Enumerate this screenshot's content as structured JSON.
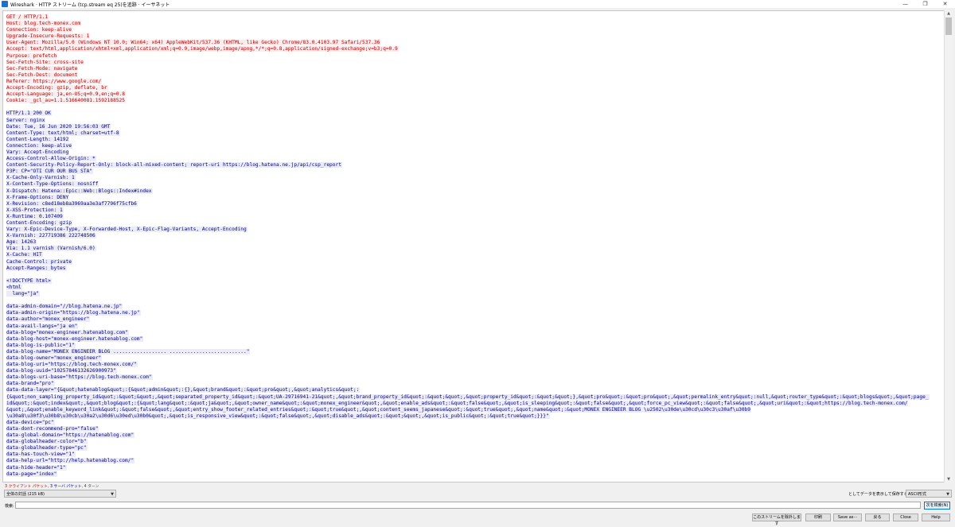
{
  "window": {
    "title": "Wireshark · HTTP ストリーム (tcp.stream eq 25)を追跡 · イーサネット",
    "controls": [
      "—",
      "❐",
      "✕"
    ]
  },
  "stream": {
    "lines": [
      {
        "side": "client",
        "text": "GET / HTTP/1.1"
      },
      {
        "side": "client",
        "text": "Host: blog.tech-monex.com"
      },
      {
        "side": "client",
        "text": "Connection: keep-alive"
      },
      {
        "side": "client",
        "text": "Upgrade-Insecure-Requests: 1"
      },
      {
        "side": "client",
        "text": "User-Agent: Mozilla/5.0 (Windows NT 10.0; Win64; x64) AppleWebKit/537.36 (KHTML, like Gecko) Chrome/83.0.4103.97 Safari/537.36"
      },
      {
        "side": "client",
        "text": "Accept: text/html,application/xhtml+xml,application/xml;q=0.9,image/webp,image/apng,*/*;q=0.8,application/signed-exchange;v=b3;q=0.9"
      },
      {
        "side": "client",
        "text": "Purpose: prefetch"
      },
      {
        "side": "client",
        "text": "Sec-Fetch-Site: cross-site"
      },
      {
        "side": "client",
        "text": "Sec-Fetch-Mode: navigate"
      },
      {
        "side": "client",
        "text": "Sec-Fetch-Dest: document"
      },
      {
        "side": "client",
        "text": "Referer: https://www.google.com/"
      },
      {
        "side": "client",
        "text": "Accept-Encoding: gzip, deflate, br"
      },
      {
        "side": "client",
        "text": "Accept-Language: ja,en-US;q=0.9,en;q=0.8"
      },
      {
        "side": "client",
        "text": "Cookie: _gcl_au=1.1.516640081.1592188525"
      },
      {
        "side": "blank",
        "text": ""
      },
      {
        "side": "server",
        "text": "HTTP/1.1 200 OK"
      },
      {
        "side": "server",
        "text": "Server: nginx"
      },
      {
        "side": "server",
        "text": "Date: Tue, 16 Jun 2020 19:56:03 GMT"
      },
      {
        "side": "server",
        "text": "Content-Type: text/html; charset=utf-8"
      },
      {
        "side": "server",
        "text": "Content-Length: 14192"
      },
      {
        "side": "server",
        "text": "Connection: keep-alive"
      },
      {
        "side": "server",
        "text": "Vary: Accept-Encoding"
      },
      {
        "side": "server",
        "text": "Access-Control-Allow-Origin: *"
      },
      {
        "side": "server",
        "text": "Content-Security-Policy-Report-Only: block-all-mixed-content; report-uri https://blog.hatena.ne.jp/api/csp_report"
      },
      {
        "side": "server",
        "text": "P3P: CP=\"OTI CUR OUR BUS STA\""
      },
      {
        "side": "server",
        "text": "X-Cache-Only-Varnish: 1"
      },
      {
        "side": "server",
        "text": "X-Content-Type-Options: nosniff"
      },
      {
        "side": "server",
        "text": "X-Dispatch: Hatena::Epic::Web::Blogs::Index#index"
      },
      {
        "side": "server",
        "text": "X-Frame-Options: DENY"
      },
      {
        "side": "server",
        "text": "X-Revision: c8ed18eb8a3969aa3e3af7796f75cfb6"
      },
      {
        "side": "server",
        "text": "X-XSS-Protection: 1"
      },
      {
        "side": "server",
        "text": "X-Runtime: 0.107409"
      },
      {
        "side": "server",
        "text": "Content-Encoding: gzip"
      },
      {
        "side": "server",
        "text": "Vary: X-Epic-Device-Type, X-Forwarded-Host, X-Epic-Flag-Variants, Accept-Encoding"
      },
      {
        "side": "server",
        "text": "X-Varnish: 227719386 222748506"
      },
      {
        "side": "server",
        "text": "Age: 14263"
      },
      {
        "side": "server",
        "text": "Via: 1.1 varnish (Varnish/6.0)"
      },
      {
        "side": "server",
        "text": "X-Cache: HIT"
      },
      {
        "side": "server",
        "text": "Cache-Control: private"
      },
      {
        "side": "server",
        "text": "Accept-Ranges: bytes"
      },
      {
        "side": "blank",
        "text": ""
      },
      {
        "side": "server",
        "text": "<!DOCTYPE html>"
      },
      {
        "side": "server",
        "text": "<html"
      },
      {
        "side": "server",
        "text": "  lang=\"ja\""
      },
      {
        "side": "blank",
        "text": ""
      },
      {
        "side": "server",
        "text": "data-admin-domain=\"//blog.hatena.ne.jp\""
      },
      {
        "side": "server",
        "text": "data-admin-origin=\"https://blog.hatena.ne.jp\""
      },
      {
        "side": "server",
        "text": "data-author=\"monex_engineer\""
      },
      {
        "side": "server",
        "text": "data-avail-langs=\"ja en\""
      },
      {
        "side": "server",
        "text": "data-blog=\"monex-engineer.hatenablog.com\""
      },
      {
        "side": "server",
        "text": "data-blog-host=\"monex-engineer.hatenablog.com\""
      },
      {
        "side": "server",
        "text": "data-blog-is-public=\"1\""
      },
      {
        "side": "server",
        "text": "data-blog-name=\"MONEX ENGINEER BLOG .................. ..........................\""
      },
      {
        "side": "server",
        "text": "data-blog-owner=\"monex_engineer\""
      },
      {
        "side": "server",
        "text": "data-blog-uri=\"https://blog.tech-monex.com/\""
      },
      {
        "side": "server",
        "text": "data-blog-uuid=\"10257846132626900973\""
      },
      {
        "side": "server",
        "text": "data-blogs-uri-base=\"https://blog.tech-monex.com\""
      },
      {
        "side": "server",
        "text": "data-brand=\"pro\""
      },
      {
        "side": "server",
        "text": "data-data-layer=\"{&quot;hatenablog&quot;:{&quot;admin&quot;:{},&quot;brand&quot;:&quot;pro&quot;,&quot;analytics&quot;:"
      },
      {
        "side": "server",
        "text": "{&quot;non_sampling_property_id&quot;:&quot;&quot;,&quot;separated_property_id&quot;:&quot;UA-29716941-21&quot;,&quot;brand_property_id&quot;:&quot;&quot;,&quot;property_id&quot;:&quot;&quot;},&quot;pro&quot;:&quot;pro&quot;,&quot;permalink_entry&quot;:null,&quot;router_type&quot;:&quot;blogs&quot;,&quot;page_"
      },
      {
        "side": "server",
        "text": "id&quot;:&quot;index&quot;,&quot;blog&quot;:{&quot;lang&quot;:&quot;ja&quot;,&quot;owner_name&quot;:&quot;monex_engineer&quot;,&quot;enable_ads&quot;:&quot;false&quot;,&quot;is_sleeping&quot;:&quot;false&quot;,&quot;force_pc_view&quot;:&quot;false&quot;,&quot;uri&quot;:&quot;https://blog.tech-monex.com/"
      },
      {
        "side": "server",
        "text": "&quot;,&quot;enable_keyword_link&quot;:&quot;false&quot;,&quot;entry_show_footer_related_entries&quot;:&quot;true&quot;,&quot;content_seems_japanese&quot;:&quot;true&quot;,&quot;name&quot;:&quot;MONEX ENGINEER BLOG \\u2502\\u30de\\u30cd\\u30c3\\u30af\\u30b9"
      },
      {
        "side": "server",
        "text": "\\u30a8\\u30f3\\u30b8\\u30cb\\u30a2\\u30d6\\u30ed\\u30b0&quot;,&quot;is_responsive_view&quot;:&quot;false&quot;,&quot;disable_ads&quot;:&quot;&quot;,&quot;is_public&quot;:&quot;true&quot;}}}\""
      },
      {
        "side": "server",
        "text": "data-device=\"pc\""
      },
      {
        "side": "server",
        "text": "data-dont-recommend-pro=\"false\""
      },
      {
        "side": "server",
        "text": "data-global-domain=\"https://hatenablog.com\""
      },
      {
        "side": "server",
        "text": "data-globalheader-color=\"b\""
      },
      {
        "side": "server",
        "text": "data-globalheader-type=\"pc\""
      },
      {
        "side": "server",
        "text": "data-has-touch-view=\"1\""
      },
      {
        "side": "server",
        "text": "data-help-url=\"http://help.hatenablog.com/\""
      },
      {
        "side": "server",
        "text": "data-hide-header=\"1\""
      },
      {
        "side": "server",
        "text": "data-page=\"index\""
      }
    ]
  },
  "legend": {
    "client": "3 クライアント パケット",
    "server": "3 サーバ パケット",
    "turns": "4 ターン"
  },
  "controls": {
    "conversation_select": "全体の対話 (215 kB)",
    "show_save_label": "としてデータを表示して保存する",
    "format_select": "ASCII形式",
    "search_label": "検索:",
    "search_value": "",
    "find_next": "次を検索(N)",
    "buttons": {
      "filter_out": "このストリームを除外します",
      "print": "印刷",
      "save_as": "Save as···",
      "back": "戻る",
      "close": "Close",
      "help": "Help"
    }
  },
  "colors": {
    "client_text": "#b80000",
    "client_bg": "#fbeded",
    "server_text": "#000080",
    "server_bg": "#ececf9"
  }
}
